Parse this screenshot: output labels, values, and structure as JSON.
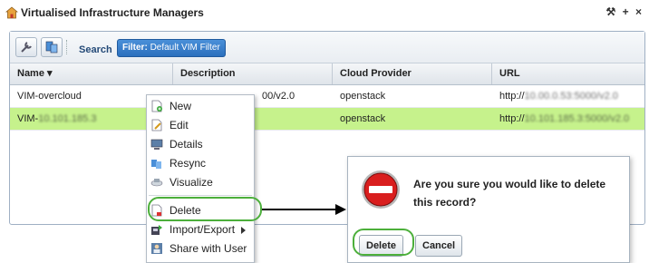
{
  "window": {
    "title": "Virtualised Infrastructure Managers",
    "controls": "⚒ + ×"
  },
  "toolbar": {
    "search_label": "Search",
    "filter_prefix": "Filter:",
    "filter_value": "Default VIM Filter"
  },
  "grid": {
    "columns": [
      "Name ▾",
      "Description",
      "Cloud Provider",
      "URL"
    ],
    "rows": [
      {
        "name": "VIM-overcloud",
        "description": "00/v2.0",
        "provider": "openstack",
        "url_prefix": "http://",
        "url_rest": "10.00.0.53:5000/v2.0"
      },
      {
        "name_prefix": "VIM-",
        "name_rest": "10.101.185.3",
        "provider": "openstack",
        "url_prefix": "http://",
        "url_rest": "10.101.185.3:5000/v2.0"
      }
    ]
  },
  "context_menu": {
    "items": [
      {
        "label": "New",
        "icon": "new-doc-icon"
      },
      {
        "label": "Edit",
        "icon": "edit-doc-icon"
      },
      {
        "label": "Details",
        "icon": "details-icon"
      },
      {
        "label": "Resync",
        "icon": "resync-icon"
      },
      {
        "label": "Visualize",
        "icon": "visualize-icon"
      },
      {
        "label": "Delete",
        "icon": "delete-doc-icon"
      },
      {
        "label": "Import/Export",
        "icon": "import-export-icon"
      },
      {
        "label": "Share with User",
        "icon": "share-user-icon"
      }
    ]
  },
  "dialog": {
    "message": "Are you sure you would like to delete this record?",
    "delete_label": "Delete",
    "cancel_label": "Cancel",
    "icon": "stop-icon"
  },
  "colors": {
    "selected_row": "#c6f28c",
    "highlight": "#4caf3b",
    "filter_button": "#2b6fbd"
  }
}
